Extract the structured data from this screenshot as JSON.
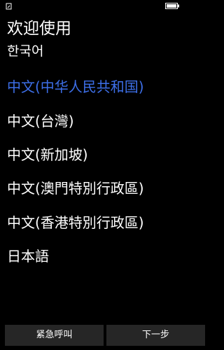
{
  "status_bar": {
    "left_icon": "sim-status-icon",
    "battery_icon": "battery-icon"
  },
  "page": {
    "title": "欢迎使用"
  },
  "languages": [
    {
      "label": "한국어",
      "selected": false
    },
    {
      "label": "中文(中华人民共和国)",
      "selected": true
    },
    {
      "label": "中文(台灣)",
      "selected": false
    },
    {
      "label": "中文(新加坡)",
      "selected": false
    },
    {
      "label": "中文(澳門特別行政區)",
      "selected": false
    },
    {
      "label": "中文(香港特別行政區)",
      "selected": false
    },
    {
      "label": "日本語",
      "selected": false
    }
  ],
  "colors": {
    "background": "#000000",
    "selected_text": "#3d6fe8",
    "button_background": "#262626"
  },
  "buttons": {
    "emergency_call": "紧急呼叫",
    "next": "下一步"
  }
}
